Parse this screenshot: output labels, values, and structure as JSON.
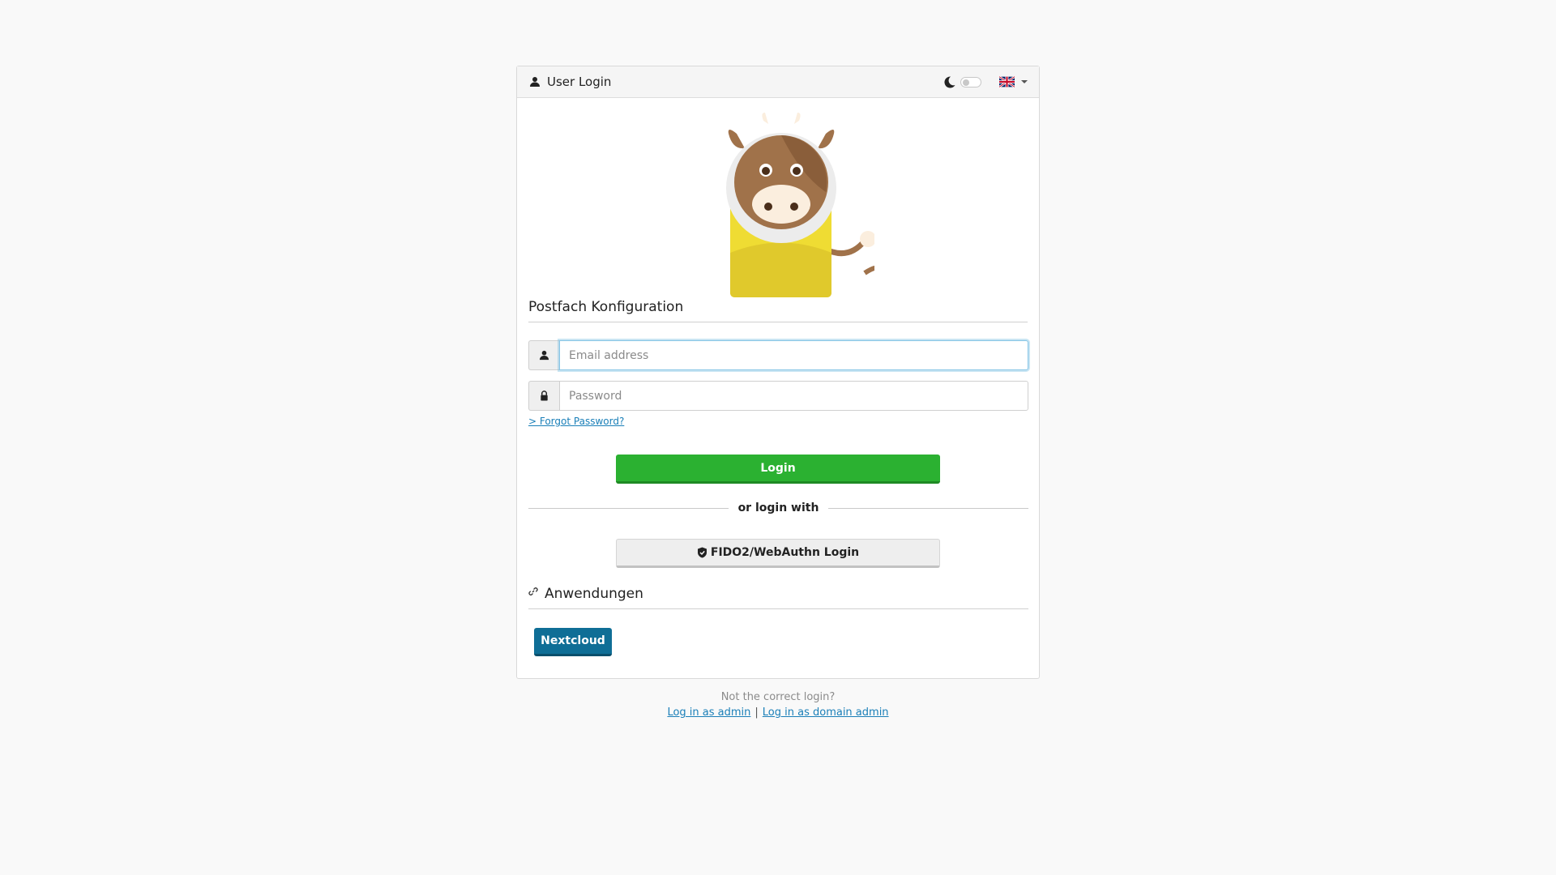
{
  "header": {
    "title": "User Login",
    "title_icon": "user-icon",
    "theme_icon": "moon-icon",
    "language_icon": "uk-flag-icon"
  },
  "mailbox": {
    "title": "Postfach Konfiguration",
    "email_placeholder": "Email address",
    "password_placeholder": "Password",
    "forgot_label": "> Forgot Password?",
    "login_label": "Login",
    "alt_login_divider": "or login with",
    "fido_label": "FIDO2/WebAuthn Login"
  },
  "apps": {
    "title": "Anwendungen",
    "items": [
      {
        "label": "Nextcloud"
      }
    ]
  },
  "footer": {
    "note": "Not the correct login?",
    "admin_link": "Log in as admin",
    "separator": "|",
    "domain_admin_link": "Log in as domain admin"
  },
  "colors": {
    "login_button": "#2bb131",
    "app_button": "#0f6e96",
    "link": "#1a7fb8"
  }
}
